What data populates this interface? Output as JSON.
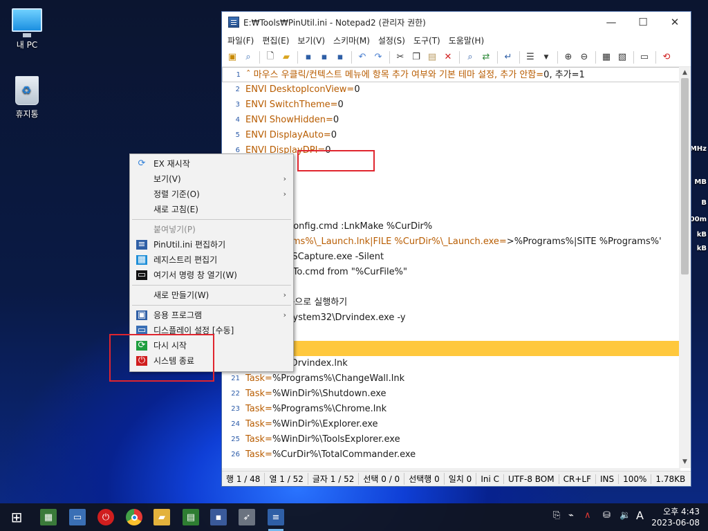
{
  "desktop": {
    "icons": [
      {
        "label": "내 PC"
      },
      {
        "label": "휴지통"
      }
    ],
    "gadget": [
      "MHz",
      "MB",
      "B",
      "00m",
      "kB",
      "kB"
    ]
  },
  "window": {
    "title": "E:₩Tools₩PinUtil.ini - Notepad2 (관리자 권한)",
    "menu": [
      "파일(F)",
      "편집(E)",
      "보기(V)",
      "스키마(M)",
      "설정(S)",
      "도구(T)",
      "도움말(H)"
    ],
    "lines": [
      {
        "n": "1",
        "k": "ˆ 마우스 우클릭/컨텍스트 메뉴에 항목 추가 여부와 기본 테마 설정, 추가 안함=",
        "v": "0, 추가=1"
      },
      {
        "n": "2",
        "k": "ENVI DesktopIconView=",
        "v": "0"
      },
      {
        "n": "3",
        "k": "ENVI SwitchTheme=",
        "v": "0"
      },
      {
        "n": "4",
        "k": "ENVI ShowHidden=",
        "v": "0"
      },
      {
        "n": "5",
        "k": "ENVI DisplayAuto=",
        "v": "0"
      },
      {
        "n": "6",
        "k": "ENVI DisplayDPI=",
        "v": "0"
      },
      {
        "n": "",
        "k": "own=",
        "v": "1"
      },
      {
        "n": "",
        "k": "heme=",
        "v": "0"
      },
      {
        "n": "",
        "k": "",
        "v": "ng"
      },
      {
        "n": "",
        "k": "",
        "v": ""
      },
      {
        "n": "",
        "k": "",
        "v": "WinDir%\\Config.cmd :LnkMake %CurDir%"
      },
      {
        "n": "",
        "k": "E %Programs%\\_Launch.lnk|FILE %CurDir%\\_Launch.exe=",
        "v": ">%Programs%|SITE %Programs%'"
      },
      {
        "n": "",
        "k": "",
        "v": "WinDir%\\FSCapture.exe -Silent"
      },
      {
        "n": "",
        "k": "",
        "v": "urDir%\\PinTo.cmd from \"%CurFile%\""
      },
      {
        "n": "",
        "k": "",
        "v": ""
      },
      {
        "n": "",
        "k": "",
        "v": "vindex 자동으로 실행하기"
      },
      {
        "n": "",
        "k": "",
        "v": "WinDir%\\System32\\Drvindex.exe -y"
      },
      {
        "n": "",
        "k": "",
        "v": ""
      },
      {
        "n": "",
        "k": "",
        "v": ""
      },
      {
        "n": "",
        "k": "",
        "v": "ograms%\\Drvindex.lnk"
      },
      {
        "n": "21",
        "k": "Task=",
        "v": "%Programs%\\ChangeWall.lnk"
      },
      {
        "n": "22",
        "k": "Task=",
        "v": "%WinDir%\\Shutdown.exe"
      },
      {
        "n": "23",
        "k": "Task=",
        "v": "%Programs%\\Chrome.lnk"
      },
      {
        "n": "24",
        "k": "Task=",
        "v": "%WinDir%\\Explorer.exe"
      },
      {
        "n": "25",
        "k": "Task=",
        "v": "%WinDir%\\ToolsExplorer.exe"
      },
      {
        "n": "26",
        "k": "Task=",
        "v": "%CurDir%\\TotalCommander.exe"
      }
    ],
    "status": [
      "행 1 / 48",
      "열 1 / 52",
      "글자 1 / 52",
      "선택 0 / 0",
      "선택행 0",
      "일치 0",
      "Ini C",
      "UTF-8 BOM",
      "CR+LF",
      "INS",
      "100%",
      "1.78KB"
    ]
  },
  "context_menu": {
    "items": [
      {
        "label": "EX 재시작",
        "icon": "refresh-icon",
        "sub": false,
        "disabled": false
      },
      {
        "label": "보기(V)",
        "icon": "",
        "sub": true,
        "disabled": false
      },
      {
        "label": "정렬 기준(O)",
        "icon": "",
        "sub": true,
        "disabled": false
      },
      {
        "label": "새로 고침(E)",
        "icon": "",
        "sub": false,
        "disabled": false
      },
      {
        "sep": true
      },
      {
        "label": "붙여넣기(P)",
        "icon": "",
        "sub": false,
        "disabled": true
      },
      {
        "label": "PinUtil.ini 편집하기",
        "icon": "notepad-icon",
        "sub": false,
        "disabled": false
      },
      {
        "label": "레지스트리 편집기",
        "icon": "registry-icon",
        "sub": false,
        "disabled": false
      },
      {
        "label": "여기서 명령 창 열기(W)",
        "icon": "cmd-icon",
        "sub": false,
        "disabled": false
      },
      {
        "sep": true
      },
      {
        "label": "새로 만들기(W)",
        "icon": "",
        "sub": true,
        "disabled": false
      },
      {
        "sep": true
      },
      {
        "label": "응용 프로그램",
        "icon": "apps-icon",
        "sub": true,
        "disabled": false
      },
      {
        "label": "디스플레이 설정 [수동]",
        "icon": "display-icon",
        "sub": false,
        "disabled": false
      },
      {
        "label": "다시 시작",
        "icon": "restart-icon",
        "sub": false,
        "disabled": false
      },
      {
        "label": "시스템 종료",
        "icon": "power-icon",
        "sub": false,
        "disabled": false
      }
    ]
  },
  "taskbar": {
    "clock_time": "오후 4:43",
    "clock_date": "2023-06-08",
    "ime": "A"
  }
}
